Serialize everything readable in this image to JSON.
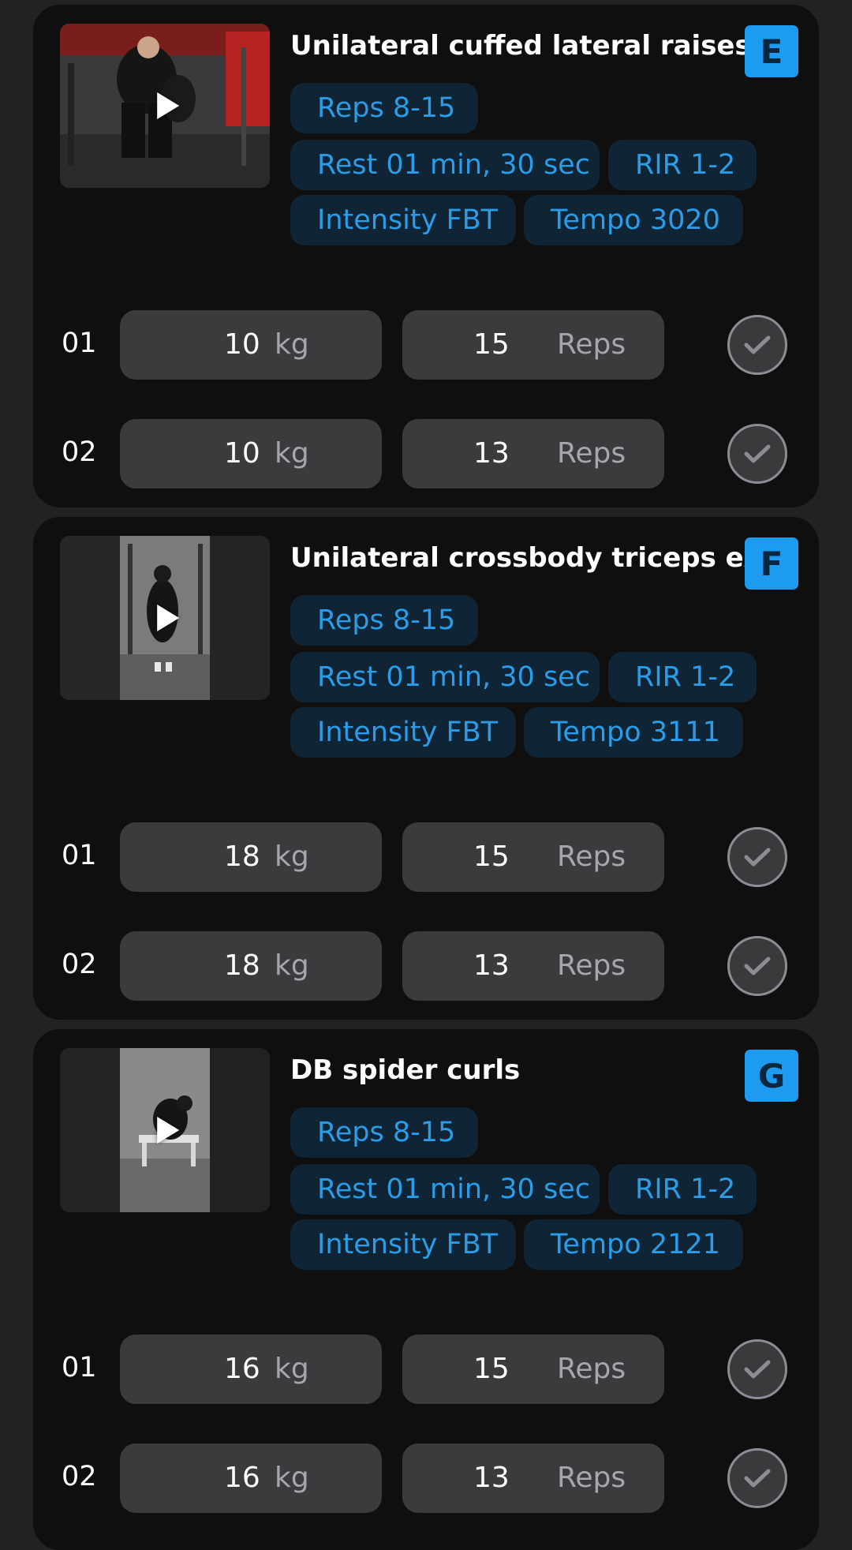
{
  "exercises": [
    {
      "title": "Unilateral cuffed lateral raises",
      "letter": "E",
      "chips": {
        "reps": "Reps 8-15",
        "rest": "Rest 01 min, 30 sec",
        "rir": "RIR 1-2",
        "intensity": "Intensity FBT",
        "tempo": "Tempo 3020"
      },
      "sets": [
        {
          "num": "01",
          "weight": "10",
          "weight_unit": "kg",
          "reps": "15",
          "reps_unit": "Reps"
        },
        {
          "num": "02",
          "weight": "10",
          "weight_unit": "kg",
          "reps": "13",
          "reps_unit": "Reps"
        }
      ]
    },
    {
      "title": "Unilateral crossbody triceps ext",
      "letter": "F",
      "chips": {
        "reps": "Reps 8-15",
        "rest": "Rest 01 min, 30 sec",
        "rir": "RIR 1-2",
        "intensity": "Intensity FBT",
        "tempo": "Tempo 3111"
      },
      "sets": [
        {
          "num": "01",
          "weight": "18",
          "weight_unit": "kg",
          "reps": "15",
          "reps_unit": "Reps"
        },
        {
          "num": "02",
          "weight": "18",
          "weight_unit": "kg",
          "reps": "13",
          "reps_unit": "Reps"
        }
      ]
    },
    {
      "title": "DB spider curls",
      "letter": "G",
      "chips": {
        "reps": "Reps 8-15",
        "rest": "Rest 01 min, 30 sec",
        "rir": "RIR 1-2",
        "intensity": "Intensity FBT",
        "tempo": "Tempo 2121"
      },
      "sets": [
        {
          "num": "01",
          "weight": "16",
          "weight_unit": "kg",
          "reps": "15",
          "reps_unit": "Reps"
        },
        {
          "num": "02",
          "weight": "16",
          "weight_unit": "kg",
          "reps": "13",
          "reps_unit": "Reps"
        }
      ]
    }
  ],
  "colors": {
    "accent": "#1d9bf0",
    "chip_text": "#2a9ce8",
    "chip_bg": "#0f2434",
    "card_bg": "#0f0f10",
    "page_bg": "#222224",
    "field_bg": "#3b3b3e"
  },
  "icons": {
    "thumbnail_overlay": "play-icon",
    "set_action": "check-icon"
  }
}
